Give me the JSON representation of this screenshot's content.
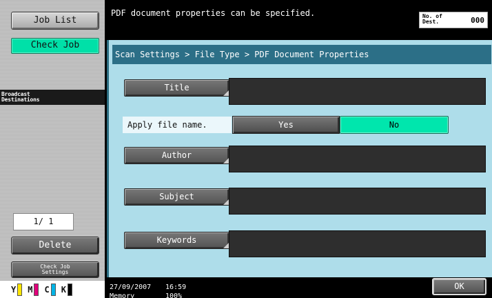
{
  "left_panel": {
    "job_list": "Job List",
    "check_job": "Check Job",
    "broadcast_line1": "Broadcast",
    "broadcast_line2": "Destinations",
    "page_counter": "1/  1",
    "delete": "Delete",
    "check_settings_line1": "Check Job",
    "check_settings_line2": "Settings",
    "toner": [
      {
        "letter": "Y",
        "color": "#ffe600"
      },
      {
        "letter": "M",
        "color": "#e0007a"
      },
      {
        "letter": "C",
        "color": "#00b4e6"
      },
      {
        "letter": "K",
        "color": "#000000"
      }
    ]
  },
  "top_bar": {
    "message": "PDF document properties can be specified.",
    "dest_label_line1": "No. of",
    "dest_label_line2": "Dest.",
    "dest_value": "000"
  },
  "main": {
    "breadcrumb": "Scan Settings > File Type > PDF Document Properties",
    "title_button": "Title",
    "title_value": "",
    "apply_file_name_label": "Apply file name.",
    "yes_option": "Yes",
    "no_option": "No",
    "author_button": "Author",
    "author_value": "",
    "subject_button": "Subject",
    "subject_value": "",
    "keywords_button": "Keywords",
    "keywords_value": ""
  },
  "status_bar": {
    "date": "27/09/2007",
    "time": "16:59",
    "memory_label": "Memory",
    "memory_value": "100%",
    "ok": "OK"
  }
}
